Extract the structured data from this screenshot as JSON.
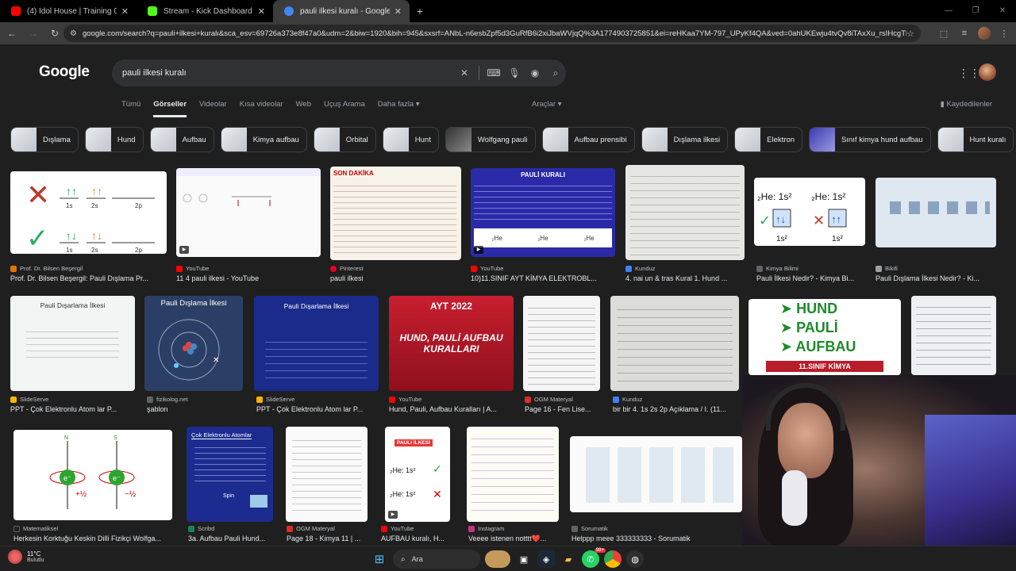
{
  "browser": {
    "tabs": [
      {
        "title": "(4) Idol House | Training 01 | De",
        "color": "#ff0000"
      },
      {
        "title": "Stream - Kick Dashboard",
        "color": "#53fc18"
      },
      {
        "title": "pauli ilkesi kuralı - Google'da A",
        "color": "#4285f4"
      }
    ],
    "url": "google.com/search?q=pauli+ilkesi+kuralı&sca_esv=69726a373e8f47a0&udm=2&biw=1920&bih=945&sxsrf=ANbL-n6esbZpf5d3GuRfB6i2xiJbaWVjqQ%3A1774903725851&ei=reHKaa7YM-797_UPyKf4QA&ved=0ahUKEwju4tvQv8iTAxXu_rsIHcgThg..."
  },
  "google": {
    "logo": "Google",
    "query": "pauli ilkesi kuralı",
    "nav_tabs": [
      "Tümü",
      "Görseller",
      "Videolar",
      "Kısa videolar",
      "Web",
      "Uçuş Arama",
      "Daha fazla"
    ],
    "active_tab": "Görseller",
    "tools": "Araçlar",
    "saved": "Kaydedilenler"
  },
  "chips": [
    "Dışlama",
    "Hund",
    "Aufbau",
    "Kimya aufbau",
    "Orbital",
    "Hunt",
    "Wolfgang pauli",
    "Aufbau prensibi",
    "Dışlama ilkesi",
    "Elektron",
    "Sınıf kimya hund aufbau",
    "Hunt kuralı"
  ],
  "results_row1": [
    {
      "source": "Prof. Dr. Bilsen Beşergil",
      "caption": "Prof. Dr. Bilsen Beşergil: Pauli Dışlama Pr...",
      "icon": "#e37400"
    },
    {
      "source": "YouTube",
      "caption": "11 4 pauli ilkesi - YouTube",
      "icon": "#ff0000"
    },
    {
      "source": "Pinterest",
      "caption": "pauli ilkesi",
      "icon": "#e60023"
    },
    {
      "source": "YouTube",
      "caption": "10)11.SINIF AYT KİMYA ELEKTROBL...",
      "icon": "#ff0000"
    },
    {
      "source": "Kunduz",
      "caption": "4. nai un & tras Kural 1. Hund ...",
      "icon": "#3b82f6"
    },
    {
      "source": "Kimya Bilimi",
      "caption": "Pauli İlkesi Nedir? - Kimya Bi...",
      "icon": "#5f6368"
    },
    {
      "source": "Bikifi",
      "caption": "Pauli Dışlama İlkesi Nedir? - Ki...",
      "icon": "#9aa0a6"
    }
  ],
  "results_row2": [
    {
      "source": "SlideServe",
      "caption": "PPT - Çok Elektronlu Atom lar P...",
      "icon": "#f4b400"
    },
    {
      "source": "fizikolog.net",
      "caption": "şablon",
      "icon": "#5f6368"
    },
    {
      "source": "SlideServe",
      "caption": "PPT - Çok Elektronlu Atom lar P...",
      "icon": "#f4b400"
    },
    {
      "source": "YouTube",
      "caption": "Hund, Pauli, Aufbau Kuralları | A...",
      "icon": "#ff0000"
    },
    {
      "source": "OGM Materyal",
      "caption": "Page 16 - Fen Lise...",
      "icon": "#d93025"
    },
    {
      "source": "Kunduz",
      "caption": "bir bir 4. 1s 2s 2p Açıklama / I. (11...",
      "icon": "#3b82f6"
    }
  ],
  "results_row3": [
    {
      "source": "Matematiksel",
      "caption": "Herkesin Korktuğu Keskin Dilli Fizikçi Wolfga...",
      "icon": "#202124"
    },
    {
      "source": "Scribd",
      "caption": "3a. Aufbau Pauli Hund...",
      "icon": "#1a7f64"
    },
    {
      "source": "OGM Materyal",
      "caption": "Page 18 - Kimya 11 | ...",
      "icon": "#d93025"
    },
    {
      "source": "YouTube",
      "caption": "AUFBAU kuralı, H...",
      "icon": "#ff0000"
    },
    {
      "source": "Instagram",
      "caption": "Veeee istenen notttt❤️...",
      "icon": "#c13584"
    },
    {
      "source": "Sorumatik",
      "caption": "Helppp meee 333333333 - Sorumatik",
      "icon": "#5f6368"
    }
  ],
  "image_text": {
    "son_dakika": "SON DAKİKA",
    "pauli_kurali": "PAULİ KURALI",
    "he_1s2": "₂He: 1s²",
    "pauli_disarlama": "Pauli Dışarlama İlkesi",
    "pauli_dislama": "Pauli Dışlama İlkesi",
    "ayt2022": "AYT 2022",
    "hund_pauli": "HUND, PAULİ AUFBAU KURALLARI",
    "hund": "➤ HUND",
    "pauli": "➤ PAULİ",
    "aufbau": "➤ AUFBAU",
    "sinif": "11.SINIF KİMYA",
    "cok_elektronlu": "Çok Elektronlu Atomlar",
    "spin": "Spin",
    "pauli_ilkesi_small": "PAULİ İLKESİ",
    "ls": "1s",
    "2s": "2s",
    "2p": "2p"
  },
  "taskbar": {
    "temp": "11°C",
    "weather": "Bulutlu",
    "search": "Ara",
    "badge": "99+"
  }
}
